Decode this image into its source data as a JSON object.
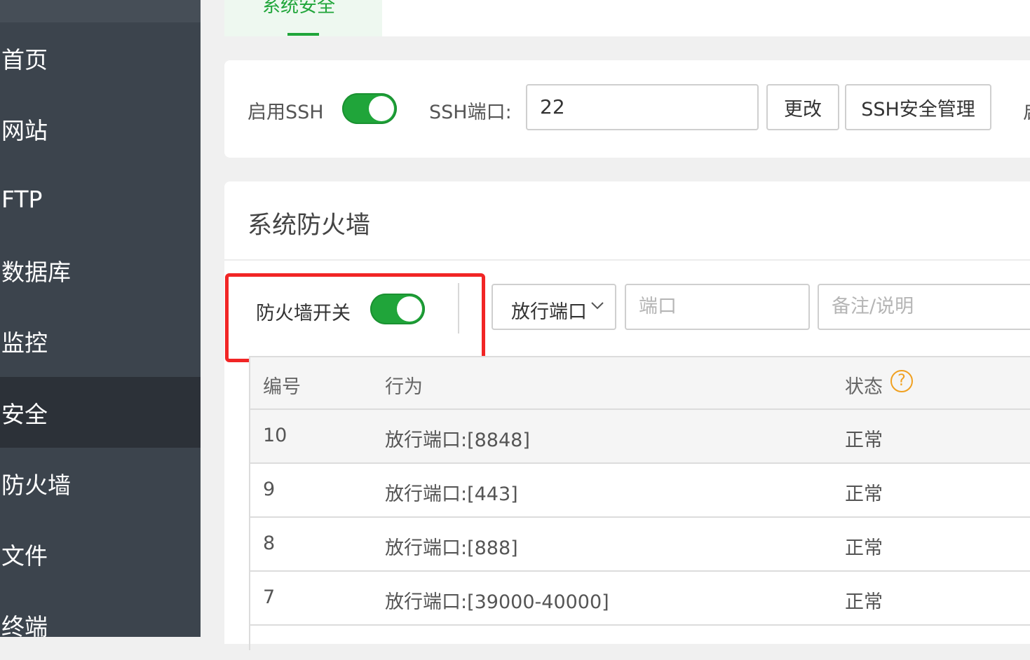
{
  "sidebar": {
    "items": [
      {
        "label": "首页"
      },
      {
        "label": "网站"
      },
      {
        "label": "FTP"
      },
      {
        "label": "数据库"
      },
      {
        "label": "监控"
      },
      {
        "label": "安全",
        "active": true
      },
      {
        "label": "防火墙"
      },
      {
        "label": "文件"
      },
      {
        "label": "终端"
      }
    ]
  },
  "tabs": {
    "active_label": "系统安全"
  },
  "ssh": {
    "enable_label": "启用SSH",
    "enabled": true,
    "port_label": "SSH端口:",
    "port_value": "22",
    "change_button": "更改",
    "manage_button": "SSH安全管理",
    "cut_label": "启"
  },
  "firewall": {
    "title": "系统防火墙",
    "switch_label": "防火墙开关",
    "switch_on": true,
    "action_select": "放行端口",
    "port_placeholder": "端口",
    "note_placeholder": "备注/说明"
  },
  "table": {
    "headers": [
      "编号",
      "行为",
      "状态"
    ],
    "rows": [
      {
        "id": "10",
        "action": "放行端口:[8848]",
        "status": "正常"
      },
      {
        "id": "9",
        "action": "放行端口:[443]",
        "status": "正常"
      },
      {
        "id": "8",
        "action": "放行端口:[888]",
        "status": "正常"
      },
      {
        "id": "7",
        "action": "放行端口:[39000-40000]",
        "status": "正常"
      }
    ]
  },
  "colors": {
    "accent": "#20a53a",
    "sidebar_bg": "#3c444d",
    "sidebar_active": "#2c3138",
    "highlight": "#f12525",
    "help": "#f0a020"
  }
}
